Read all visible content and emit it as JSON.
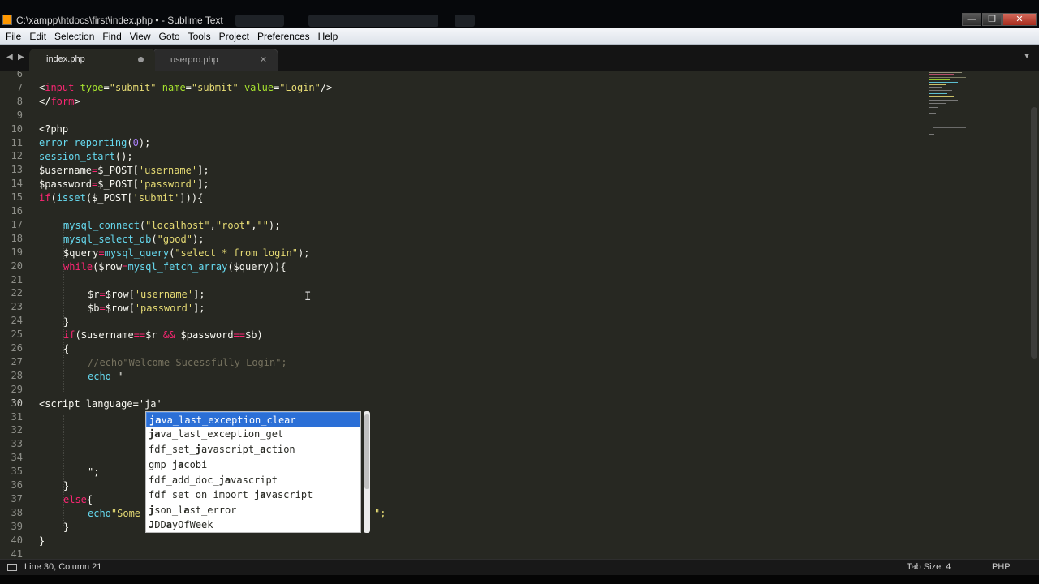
{
  "window": {
    "title": "C:\\xampp\\htdocs\\first\\index.php • - Sublime Text",
    "buttons": {
      "minimize": "—",
      "maximize": "❐",
      "close": "✕"
    }
  },
  "menu": [
    "File",
    "Edit",
    "Selection",
    "Find",
    "View",
    "Goto",
    "Tools",
    "Project",
    "Preferences",
    "Help"
  ],
  "tabs": [
    {
      "label": "index.php",
      "active": true,
      "modified": true
    },
    {
      "label": "userpro.php",
      "active": false,
      "modified": false
    }
  ],
  "line_numbers": [
    "6",
    "7",
    "8",
    "9",
    "10",
    "11",
    "12",
    "13",
    "14",
    "15",
    "16",
    "17",
    "18",
    "19",
    "20",
    "21",
    "22",
    "23",
    "24",
    "25",
    "26",
    "27",
    "28",
    "29",
    "30",
    "31",
    "32",
    "33",
    "34",
    "35",
    "36",
    "37",
    "38",
    "39",
    "40",
    "41"
  ],
  "current_line": "30",
  "code_text": {
    "l7_a": "<",
    "l7_tag": "input",
    "l7_b": " ",
    "l7_attr1": "type",
    "l7_c": "=",
    "l7_v1": "\"submit\"",
    "l7_d": " ",
    "l7_attr2": "name",
    "l7_e": "=",
    "l7_v2": "\"submit\"",
    "l7_f": " ",
    "l7_attr3": "value",
    "l7_g": "=",
    "l7_v3": "\"Login\"",
    "l7_h": "/>",
    "l8_a": "</",
    "l8_tag": "form",
    "l8_b": ">",
    "l10": "<?php",
    "l11_fn": "error_reporting",
    "l11_a": "(",
    "l11_n": "0",
    "l11_b": ");",
    "l12_fn": "session_start",
    "l12_a": "();",
    "l13_v": "$username",
    "l13_op": "=",
    "l13_a": "$_POST[",
    "l13_s": "'username'",
    "l13_b": "];",
    "l14_v": "$password",
    "l14_op": "=",
    "l14_a": "$_POST[",
    "l14_s": "'password'",
    "l14_b": "];",
    "l15_kw": "if",
    "l15_a": "(",
    "l15_fn": "isset",
    "l15_b": "($_POST[",
    "l15_s": "'submit'",
    "l15_c": "])){",
    "l17_fn": "mysql_connect",
    "l17_a": "(",
    "l17_s1": "\"localhost\"",
    "l17_b": ",",
    "l17_s2": "\"root\"",
    "l17_c": ",",
    "l17_s3": "\"\"",
    "l17_d": ");",
    "l18_fn": "mysql_select_db",
    "l18_a": "(",
    "l18_s": "\"good\"",
    "l18_b": ");",
    "l19_v": "$query",
    "l19_op": "=",
    "l19_fn": "mysql_query",
    "l19_a": "(",
    "l19_s": "\"select * from login\"",
    "l19_b": ");",
    "l20_kw": "while",
    "l20_a": "(",
    "l20_v": "$row",
    "l20_op": "=",
    "l20_fn": "mysql_fetch_array",
    "l20_b": "($query)){",
    "l22_v": "$r",
    "l22_op": "=",
    "l22_a": "$row[",
    "l22_s": "'username'",
    "l22_b": "];",
    "l23_v": "$b",
    "l23_op": "=",
    "l23_a": "$row[",
    "l23_s": "'password'",
    "l23_b": "];",
    "l24": "}",
    "l25_kw": "if",
    "l25_a": "($username",
    "l25_op1": "==",
    "l25_b": "$r ",
    "l25_op2": "&&",
    "l25_c": " $password",
    "l25_op3": "==",
    "l25_d": "$b)",
    "l26": "{",
    "l27": "//echo\"Welcome Sucessfully Login\";",
    "l28_kw": "echo",
    "l28_s": " \"",
    "l30_a": "<",
    "l30_tag": "script",
    "l30_b": " ",
    "l30_attr": "language",
    "l30_c": "=",
    "l30_s": "'ja'",
    "l35": "\";",
    "l36": "}",
    "l37_kw": "else",
    "l37_a": "{",
    "l38_kw": "echo",
    "l38_s": "\"Some",
    "l38_tail": "\";",
    "l39": "}",
    "l40": "}"
  },
  "autocomplete": {
    "items": [
      {
        "bold": "ja",
        "rest": "va_last_exception_clear"
      },
      {
        "bold": "ja",
        "rest": "va_last_exception_get"
      },
      {
        "pre": "fdf_set_",
        "bold": "j",
        "mid": "avascript_",
        "bold2": "a",
        "rest": "ction"
      },
      {
        "pre": "gmp_",
        "bold": "ja",
        "rest": "cobi"
      },
      {
        "pre": "fdf_add_doc_",
        "bold": "ja",
        "rest": "vascript"
      },
      {
        "pre": "fdf_set_on_import_",
        "bold": "ja",
        "rest": "vascript"
      },
      {
        "bold": "j",
        "mid": "son_l",
        "bold2": "a",
        "rest": "st_error"
      },
      {
        "bold": "J",
        "mid": "DD",
        "bold2": "a",
        "rest": "yOfWeek"
      }
    ],
    "selected_index": 0
  },
  "status": {
    "position": "Line 30, Column 21",
    "tab_size": "Tab Size: 4",
    "syntax": "PHP"
  },
  "icons": [
    "app-icon",
    "back-arrow-icon",
    "forward-arrow-icon",
    "tab-close-icon",
    "modified-dot-icon",
    "tab-dropdown-icon",
    "panel-toggle-icon",
    "text-cursor-icon"
  ],
  "colors": {
    "editor_bg": "#272822",
    "keyword": "#f92672",
    "string": "#e6db74",
    "function": "#66d9ef",
    "attribute": "#a6e22e",
    "number": "#ae81ff",
    "comment": "#75715e",
    "selection": "#2b6fd6"
  }
}
